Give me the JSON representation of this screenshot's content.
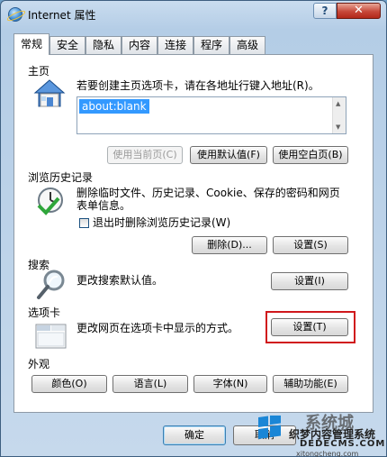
{
  "window": {
    "title": "Internet 属性",
    "help_label": "?",
    "close_label": "✕"
  },
  "tabs": [
    {
      "label": "常规",
      "active": true
    },
    {
      "label": "安全"
    },
    {
      "label": "隐私"
    },
    {
      "label": "内容"
    },
    {
      "label": "连接"
    },
    {
      "label": "程序"
    },
    {
      "label": "高级"
    }
  ],
  "homepage": {
    "group_label": "主页",
    "description": "若要创建主页选项卡，请在各地址行键入地址(R)。",
    "address_value": "about:blank",
    "use_current_label": "使用当前页(C)",
    "use_default_label": "使用默认值(F)",
    "use_blank_label": "使用空白页(B)"
  },
  "history": {
    "group_label": "浏览历史记录",
    "description_line1": "删除临时文件、历史记录、Cookie、保存的密码和网页",
    "description_line2": "表单信息。",
    "checkbox_label": "退出时删除浏览历史记录(W)",
    "checkbox_checked": false,
    "delete_label": "删除(D)...",
    "settings_label": "设置(S)"
  },
  "search": {
    "group_label": "搜索",
    "description": "更改搜索默认值。",
    "settings_label": "设置(I)"
  },
  "tabs_section": {
    "group_label": "选项卡",
    "description": "更改网页在选项卡中显示的方式。",
    "settings_label": "设置(T)"
  },
  "appearance": {
    "group_label": "外观",
    "colors_label": "颜色(O)",
    "languages_label": "语言(L)",
    "fonts_label": "字体(N)",
    "accessibility_label": "辅助功能(E)"
  },
  "footer": {
    "ok_label": "确定",
    "cancel_label": "取消"
  },
  "watermark": {
    "line1": "系统城",
    "line2": "织梦内容管理系统",
    "line3": "DEDECMS.COM",
    "line4": "xitongcheng.com"
  },
  "colors": {
    "highlight": "#d0181c",
    "selection": "#3399ff"
  }
}
